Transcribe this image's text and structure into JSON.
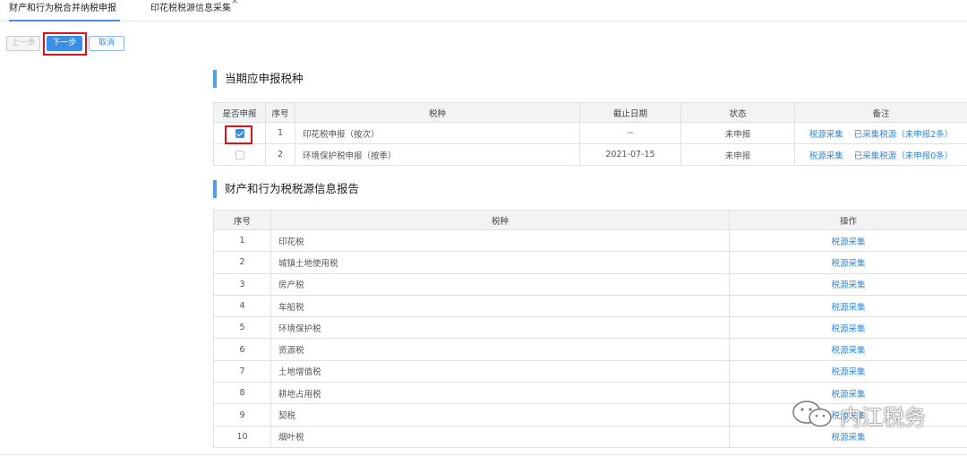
{
  "tabs": [
    {
      "label": "财产和行为税合并纳税申报"
    },
    {
      "label": "印花税税源信息采集",
      "close": "×"
    }
  ],
  "toolbar": {
    "prev": "上一步",
    "next": "下一步",
    "cancel": "取消"
  },
  "section1": {
    "title": "当期应申报税种",
    "headers": [
      "是否申报",
      "序号",
      "税种",
      "截止日期",
      "状态",
      "备注"
    ],
    "rows": [
      {
        "checked": true,
        "no": "1",
        "tax": "印花税申报（按次）",
        "deadline": "--",
        "status": "未申报",
        "link1": "税源采集",
        "link2": "已采集税源（未申报2条）"
      },
      {
        "checked": false,
        "no": "2",
        "tax": "环境保护税申报（按季）",
        "deadline": "2021-07-15",
        "status": "未申报",
        "link1": "税源采集",
        "link2": "已采集税源（未申报0条）"
      }
    ]
  },
  "section2": {
    "title": "财产和行为税税源信息报告",
    "headers": [
      "序号",
      "税种",
      "操作"
    ],
    "rows": [
      {
        "no": "1",
        "tax": "印花税",
        "op": "税源采集"
      },
      {
        "no": "2",
        "tax": "城镇土地使用税",
        "op": "税源采集"
      },
      {
        "no": "3",
        "tax": "房产税",
        "op": "税源采集"
      },
      {
        "no": "4",
        "tax": "车船税",
        "op": "税源采集"
      },
      {
        "no": "5",
        "tax": "环境保护税",
        "op": "税源采集"
      },
      {
        "no": "6",
        "tax": "资源税",
        "op": "税源采集"
      },
      {
        "no": "7",
        "tax": "土地增值税",
        "op": "税源采集"
      },
      {
        "no": "8",
        "tax": "耕地占用税",
        "op": "税源采集"
      },
      {
        "no": "9",
        "tax": "契税",
        "op": "税源采集"
      },
      {
        "no": "10",
        "tax": "烟叶税",
        "op": "税源采集"
      }
    ]
  },
  "watermark": {
    "text": "内江税务",
    "icon": "wechat-icon"
  }
}
